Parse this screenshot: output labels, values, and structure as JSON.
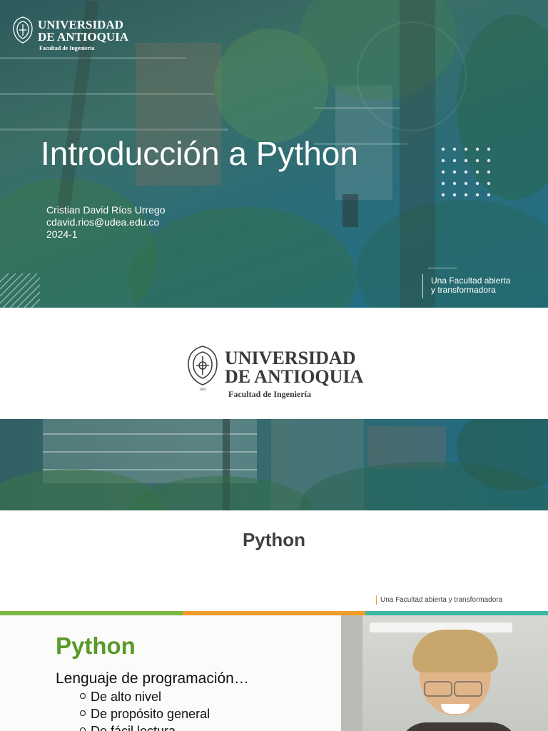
{
  "slide1": {
    "logo": {
      "university_line1": "UNIVERSIDAD",
      "university_line2": "DE ANTIOQUIA",
      "faculty": "Facultad de Ingeniería"
    },
    "title": "Introducción a Python",
    "author": {
      "name": "Cristian David Ríos Urrego",
      "email": "cdavid.rios@udea.edu.co",
      "term": "2024-1"
    },
    "motto": {
      "line1": "Una Facultad abierta",
      "line2": "y transformadora"
    },
    "colors": {
      "overlay_start": "#2d5a5c",
      "overlay_end": "#1f6f8a"
    }
  },
  "slide2": {
    "logo": {
      "university_line1": "UNIVERSIDAD",
      "university_line2": "DE ANTIOQUIA",
      "faculty": "Facultad de Ingeniería",
      "founded": "1803"
    },
    "title": "Python",
    "motto": "Una Facultad abierta y transformadora"
  },
  "slide3": {
    "title": "Python",
    "lead": "Lenguaje de programación…",
    "bullets": [
      "De alto nivel",
      "De propósito general",
      "De fácil lectura"
    ],
    "colors": {
      "stripe_green": "#7ab844",
      "stripe_orange": "#f39c2b",
      "stripe_teal": "#3fb5a5",
      "title": "#5b9a2a"
    }
  }
}
